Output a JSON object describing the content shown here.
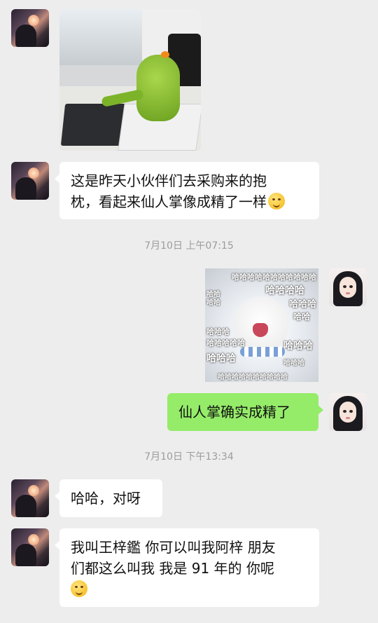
{
  "messages": [
    {
      "id": "m1",
      "side": "left",
      "type": "image",
      "image": "office-plush-photo"
    },
    {
      "id": "m2",
      "side": "left",
      "type": "text",
      "lines": [
        "这是昨天小伙伴们去采购来的抱",
        "枕，看起来仙人掌像成精了一样"
      ],
      "emoji": "thinking-face"
    },
    {
      "id": "t1",
      "type": "time",
      "text": "7月10日 上午07:15"
    },
    {
      "id": "m3",
      "side": "right",
      "type": "image",
      "image": "laughing-cat-meme",
      "overlay": [
        "哈哈哈哈哈哈哈哈哈哈哈",
        "哈哈哈哈",
        "哈哈哈",
        "哈哈",
        "哈哈",
        "哈哈",
        "哈哈哈",
        "哈哈哈哈哈",
        "哈哈哈",
        "哈哈哈",
        "哈哈哈",
        "哈哈哈哈哈哈哈哈哈哈"
      ]
    },
    {
      "id": "m4",
      "side": "right",
      "type": "text",
      "text": "仙人掌确实成精了"
    },
    {
      "id": "t2",
      "type": "time",
      "text": "7月10日 下午13:34"
    },
    {
      "id": "m5",
      "side": "left",
      "type": "text",
      "text": "哈哈，对呀"
    },
    {
      "id": "m6",
      "side": "left",
      "type": "text",
      "lines": [
        "我叫王梓鑑 你可以叫我阿梓 朋友",
        "们都这么叫我 我是 91 年的 你呢"
      ],
      "emoji": "smiling-face"
    }
  ],
  "colors": {
    "background": "#ededed",
    "incoming_bubble": "#ffffff",
    "outgoing_bubble": "#95ec69",
    "timestamp": "#9c9c9c"
  }
}
